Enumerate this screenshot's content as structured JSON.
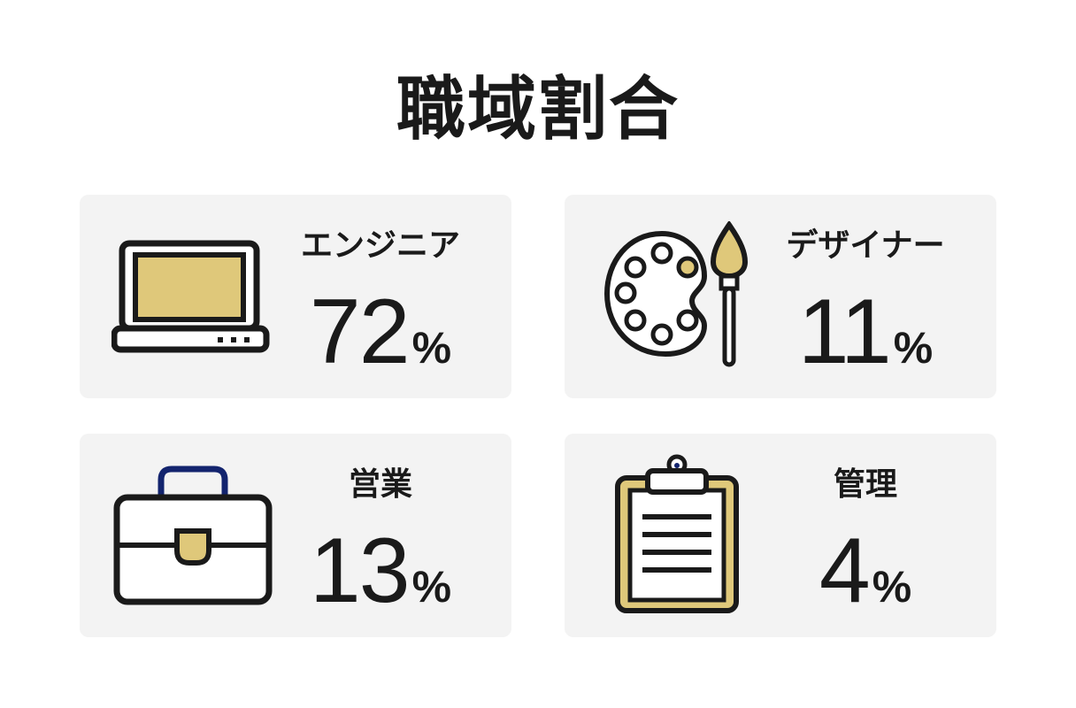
{
  "title": "職域割合",
  "colors": {
    "card_bg": "#f3f3f3",
    "accent_gold": "#dfc87a",
    "handle_navy": "#13246e",
    "ink": "#1a1a1a"
  },
  "cards": [
    {
      "label": "エンジニア",
      "value": "72",
      "unit": "%",
      "icon": "laptop-icon"
    },
    {
      "label": "デザイナー",
      "value": "11",
      "unit": "%",
      "icon": "palette-brush-icon"
    },
    {
      "label": "営業",
      "value": "13",
      "unit": "%",
      "icon": "briefcase-icon"
    },
    {
      "label": "管理",
      "value": "4",
      "unit": "%",
      "icon": "clipboard-icon"
    }
  ]
}
